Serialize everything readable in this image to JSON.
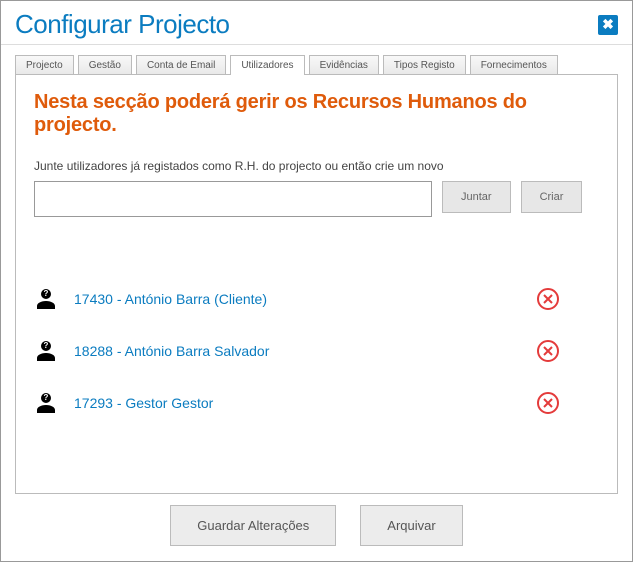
{
  "modal": {
    "title": "Configurar Projecto"
  },
  "tabs": [
    {
      "label": "Projecto"
    },
    {
      "label": "Gestão"
    },
    {
      "label": "Conta de Email"
    },
    {
      "label": "Utilizadores"
    },
    {
      "label": "Evidências"
    },
    {
      "label": "Tipos Registo"
    },
    {
      "label": "Fornecimentos"
    }
  ],
  "section": {
    "title": "Nesta secção poderá gerir os Recursos Humanos do projecto.",
    "helper": "Junte utilizadores já registados como R.H. do projecto ou então crie um novo",
    "join_label": "Juntar",
    "create_label": "Criar"
  },
  "users": [
    {
      "label": "17430 - António Barra (Cliente)"
    },
    {
      "label": "18288 - António Barra Salvador"
    },
    {
      "label": "17293 - Gestor Gestor"
    }
  ],
  "footer": {
    "save": "Guardar Alterações",
    "archive": "Arquivar"
  }
}
